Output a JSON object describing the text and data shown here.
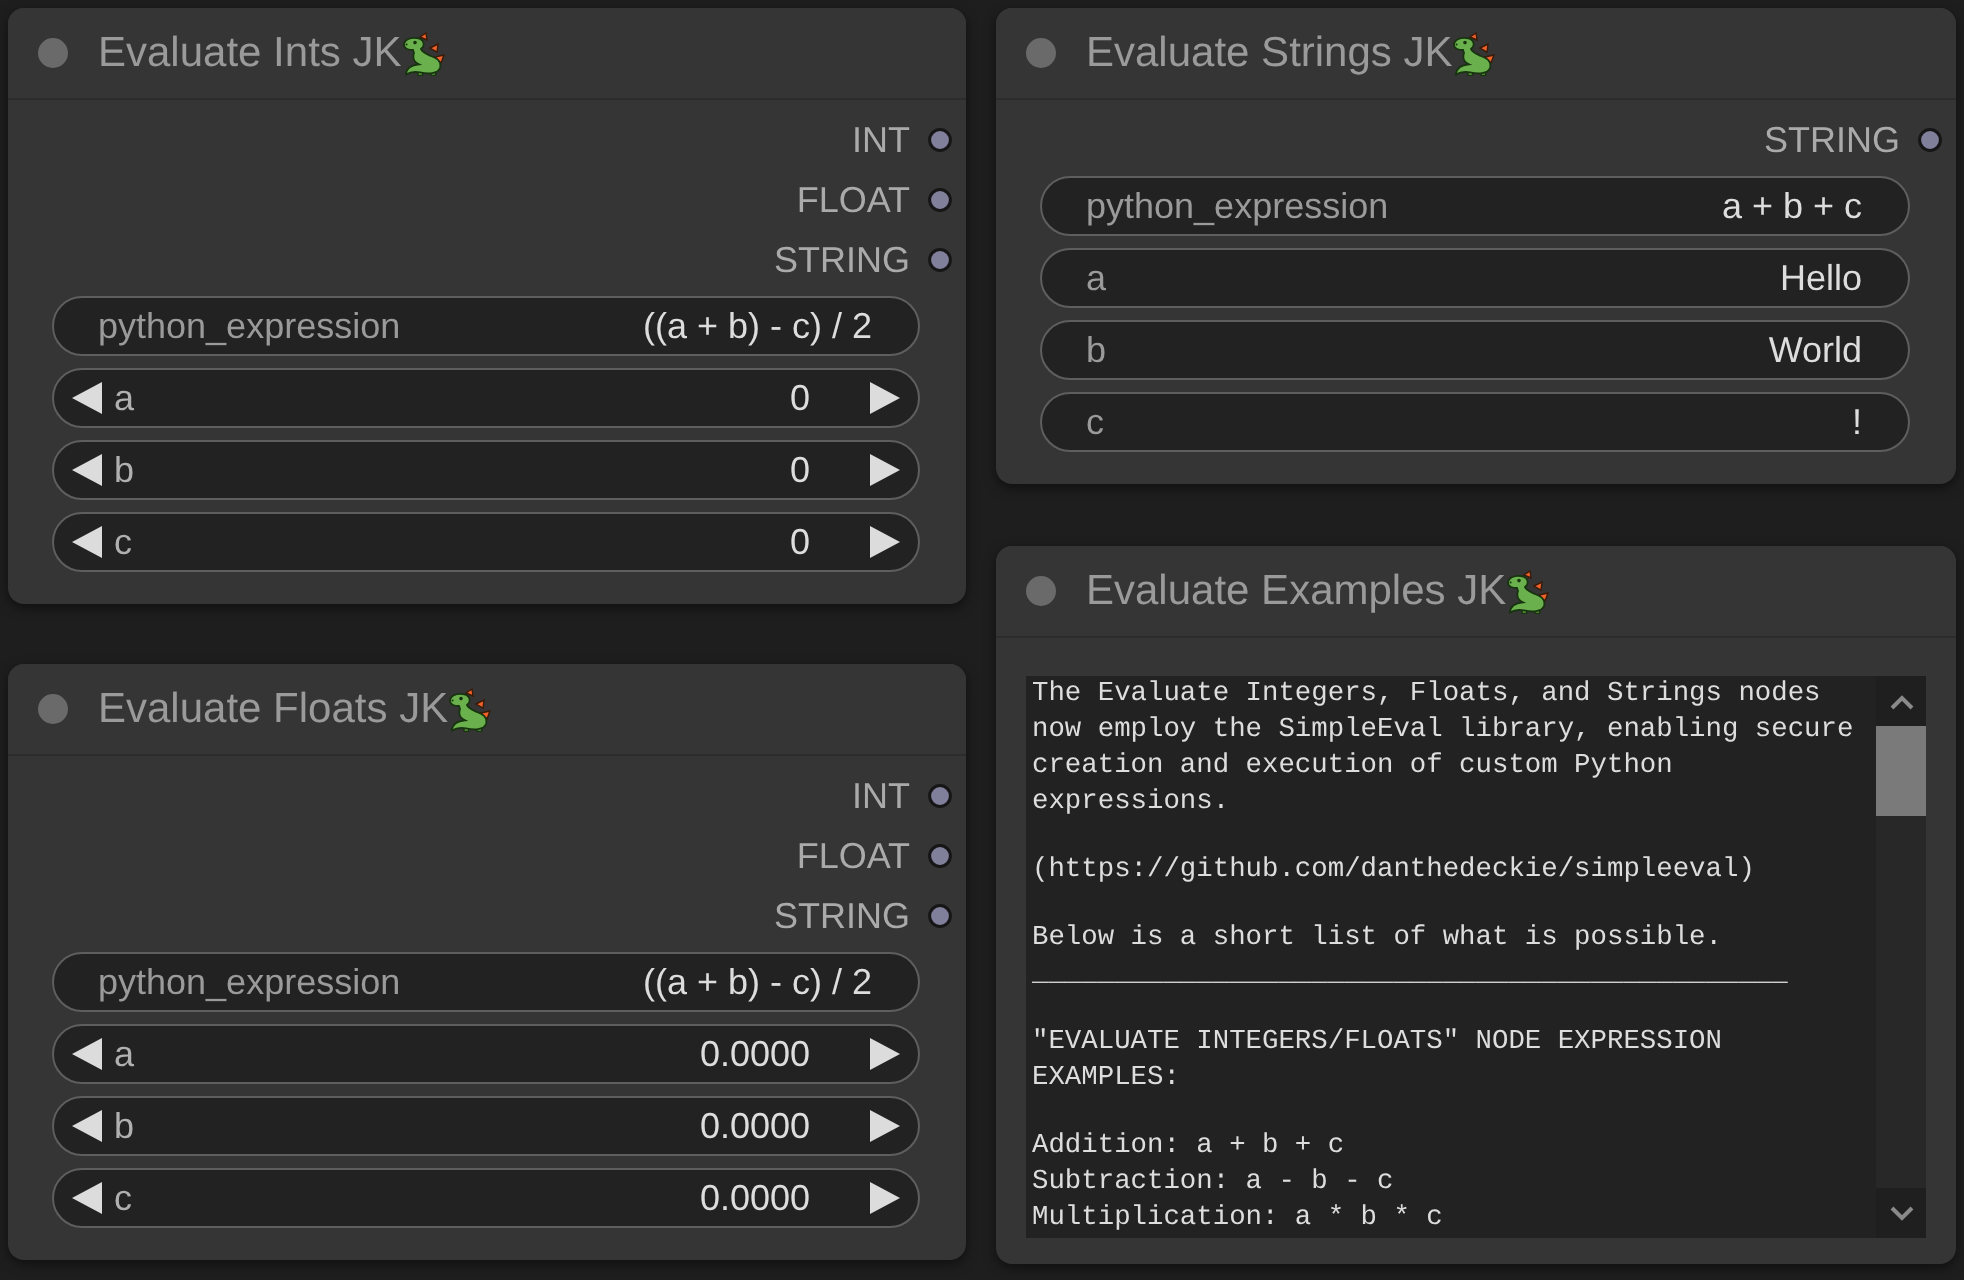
{
  "nodes": [
    {
      "title": "Evaluate Ints JK",
      "outputs": [
        "INT",
        "FLOAT",
        "STRING"
      ],
      "widgets": [
        {
          "kind": "text",
          "label": "python_expression",
          "value": "((a + b) - c) / 2"
        },
        {
          "kind": "number",
          "label": "a",
          "value": "0"
        },
        {
          "kind": "number",
          "label": "b",
          "value": "0"
        },
        {
          "kind": "number",
          "label": "c",
          "value": "0"
        }
      ]
    },
    {
      "title": "Evaluate Strings JK",
      "outputs": [
        "STRING"
      ],
      "widgets": [
        {
          "kind": "text",
          "label": "python_expression",
          "value": "a + b + c"
        },
        {
          "kind": "text",
          "label": "a",
          "value": "Hello"
        },
        {
          "kind": "text",
          "label": "b",
          "value": "World"
        },
        {
          "kind": "text",
          "label": "c",
          "value": "!"
        }
      ]
    },
    {
      "title": "Evaluate Floats JK",
      "outputs": [
        "INT",
        "FLOAT",
        "STRING"
      ],
      "widgets": [
        {
          "kind": "text",
          "label": "python_expression",
          "value": "((a + b) - c) / 2"
        },
        {
          "kind": "number",
          "label": "a",
          "value": "0.0000"
        },
        {
          "kind": "number",
          "label": "b",
          "value": "0.0000"
        },
        {
          "kind": "number",
          "label": "c",
          "value": "0.0000"
        }
      ]
    },
    {
      "title": "Evaluate Examples JK",
      "textarea": {
        "blocks": [
          {
            "lines": [
              "The Evaluate Integers, Floats, and Strings nodes now employ the SimpleEval library, enabling secure creation and execution of custom Python expressions."
            ]
          },
          {
            "lines": [
              "(https://github.com/danthedeckie/simpleeval)"
            ]
          },
          {
            "lines": [
              "Below is a short list of what is possible.",
              "______________________________________________"
            ]
          },
          {
            "lines": [
              "\"EVALUATE INTEGERS/FLOATS\" NODE EXPRESSION EXAMPLES:"
            ]
          },
          {
            "lines": [
              "Addition: a + b + c",
              "Subtraction: a - b - c",
              "Multiplication: a * b * c"
            ]
          }
        ]
      }
    }
  ]
}
